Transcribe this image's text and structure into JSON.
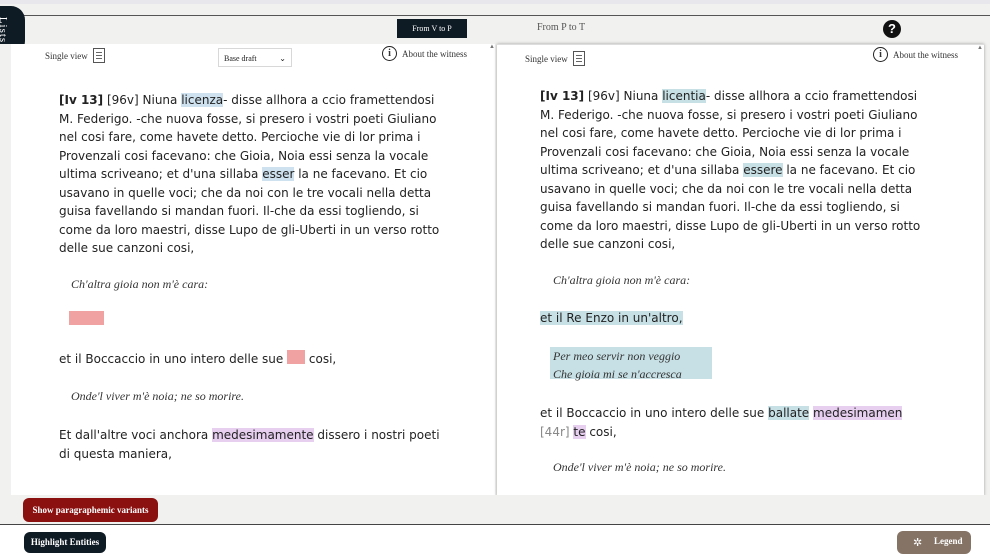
{
  "sidebar": {
    "lists_label": "Lists"
  },
  "header": {
    "tabs": [
      {
        "label": "From V to P",
        "active": true
      },
      {
        "label": "From P to T",
        "active": false
      }
    ],
    "help_label": "?"
  },
  "left_panel": {
    "single_view": "Single view",
    "draft_select": {
      "value": "Base draft"
    },
    "about": "About the witness",
    "para1": {
      "ref": "[Iv 13]",
      "p1": " [96v] Niuna ",
      "h1": "licenza",
      "p2": "- disse allhora a ccio framettendosi M. Federigo. -che nuova fosse, si presero i vostri poeti Giuliano nel cosi fare, come havete detto. Percioche vie di lor prima i Provenzali cosi facevano: che Gioia, Noia essi senza la vocale ultima scriveano; et d'una sillaba ",
      "h2": "esser",
      "p3": " la ne facevano. Et cio usavano in quelle voci; che da noi con le tre vocali nella detta guisa favellando si mandan fuori. Il-che da essi togliendo, si come da loro maestri, disse Lupo de gli-Uberti in un verso rotto delle sue canzoni cosi,"
    },
    "verse1": "Ch'altra gioia non m'è cara:",
    "para2": {
      "p1": "et il Boccaccio in uno intero delle sue ",
      "p2": " cosi,"
    },
    "verse2": "Onde'l viver m'è noia; ne so morire.",
    "para3": {
      "p1": "Et dall'altre voci anchora ",
      "h1": "medesimamente",
      "p2": " dissero i nostri poeti di questa maniera,"
    }
  },
  "right_panel": {
    "single_view": "Single view",
    "about": "About the witness",
    "para1": {
      "ref": "[Iv 13]",
      "p1": " [96v] Niuna ",
      "h1": "licentia",
      "p2": "- disse allhora a ccio framettendosi M. Federigo. -che nuova fosse, si presero i vostri poeti Giuliano nel cosi fare, come havete detto. Percioche vie di lor prima i Provenzali cosi facevano: che Gioia, Noia essi senza la vocale ultima scriveano; et d'una sillaba ",
      "h2": "essere",
      "p3": " la ne facevano. Et cio usavano in quelle voci; che da noi con le tre vocali nella detta guisa favellando si mandan fuori. Il-che da essi togliendo, si come da loro maestri, disse Lupo de gli-Uberti in un verso rotto delle sue canzoni cosi,"
    },
    "verse1": "Ch'altra gioia non m'è cara:",
    "added_line": "et il Re Enzo in un'altro,",
    "added_verse": {
      "line1": "Per meo servir non veggio",
      "line2": "Che gioia mi se n'accresca"
    },
    "para2": {
      "p1": "et il Boccaccio in uno intero delle sue ",
      "h1": "ballate",
      "h2": "medesimamen",
      "folio": "[44r]",
      "h3": "te",
      "p2": " cosi,"
    },
    "verse2": "Onde'l viver m'è noia; ne so morire."
  },
  "bottom": {
    "paragraphemic_btn": "Show paragraphemic variants",
    "entities_btn": "Highlight Entities",
    "legend_btn": "Legend"
  },
  "colors": {
    "brand_dark": "#0e1a24",
    "accent_red": "#8b1010",
    "legend_brown": "#857365",
    "hl_blue": "#cde1ee",
    "hl_purple": "#e7cff0",
    "hl_pink": "#f0a2a3"
  }
}
